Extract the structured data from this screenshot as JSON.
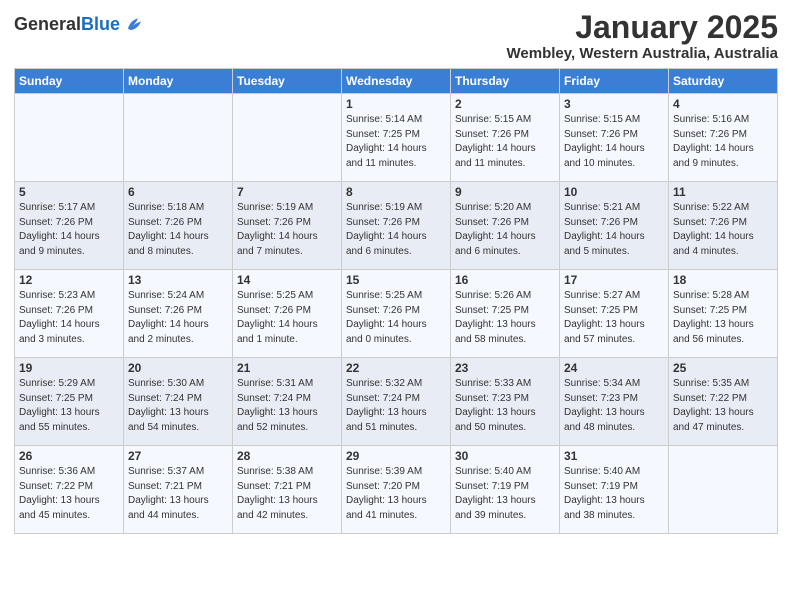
{
  "header": {
    "logo_general": "General",
    "logo_blue": "Blue",
    "month_title": "January 2025",
    "location": "Wembley, Western Australia, Australia"
  },
  "weekdays": [
    "Sunday",
    "Monday",
    "Tuesday",
    "Wednesday",
    "Thursday",
    "Friday",
    "Saturday"
  ],
  "weeks": [
    [
      {
        "day": "",
        "info": ""
      },
      {
        "day": "",
        "info": ""
      },
      {
        "day": "",
        "info": ""
      },
      {
        "day": "1",
        "info": "Sunrise: 5:14 AM\nSunset: 7:25 PM\nDaylight: 14 hours\nand 11 minutes."
      },
      {
        "day": "2",
        "info": "Sunrise: 5:15 AM\nSunset: 7:26 PM\nDaylight: 14 hours\nand 11 minutes."
      },
      {
        "day": "3",
        "info": "Sunrise: 5:15 AM\nSunset: 7:26 PM\nDaylight: 14 hours\nand 10 minutes."
      },
      {
        "day": "4",
        "info": "Sunrise: 5:16 AM\nSunset: 7:26 PM\nDaylight: 14 hours\nand 9 minutes."
      }
    ],
    [
      {
        "day": "5",
        "info": "Sunrise: 5:17 AM\nSunset: 7:26 PM\nDaylight: 14 hours\nand 9 minutes."
      },
      {
        "day": "6",
        "info": "Sunrise: 5:18 AM\nSunset: 7:26 PM\nDaylight: 14 hours\nand 8 minutes."
      },
      {
        "day": "7",
        "info": "Sunrise: 5:19 AM\nSunset: 7:26 PM\nDaylight: 14 hours\nand 7 minutes."
      },
      {
        "day": "8",
        "info": "Sunrise: 5:19 AM\nSunset: 7:26 PM\nDaylight: 14 hours\nand 6 minutes."
      },
      {
        "day": "9",
        "info": "Sunrise: 5:20 AM\nSunset: 7:26 PM\nDaylight: 14 hours\nand 6 minutes."
      },
      {
        "day": "10",
        "info": "Sunrise: 5:21 AM\nSunset: 7:26 PM\nDaylight: 14 hours\nand 5 minutes."
      },
      {
        "day": "11",
        "info": "Sunrise: 5:22 AM\nSunset: 7:26 PM\nDaylight: 14 hours\nand 4 minutes."
      }
    ],
    [
      {
        "day": "12",
        "info": "Sunrise: 5:23 AM\nSunset: 7:26 PM\nDaylight: 14 hours\nand 3 minutes."
      },
      {
        "day": "13",
        "info": "Sunrise: 5:24 AM\nSunset: 7:26 PM\nDaylight: 14 hours\nand 2 minutes."
      },
      {
        "day": "14",
        "info": "Sunrise: 5:25 AM\nSunset: 7:26 PM\nDaylight: 14 hours\nand 1 minute."
      },
      {
        "day": "15",
        "info": "Sunrise: 5:25 AM\nSunset: 7:26 PM\nDaylight: 14 hours\nand 0 minutes."
      },
      {
        "day": "16",
        "info": "Sunrise: 5:26 AM\nSunset: 7:25 PM\nDaylight: 13 hours\nand 58 minutes."
      },
      {
        "day": "17",
        "info": "Sunrise: 5:27 AM\nSunset: 7:25 PM\nDaylight: 13 hours\nand 57 minutes."
      },
      {
        "day": "18",
        "info": "Sunrise: 5:28 AM\nSunset: 7:25 PM\nDaylight: 13 hours\nand 56 minutes."
      }
    ],
    [
      {
        "day": "19",
        "info": "Sunrise: 5:29 AM\nSunset: 7:25 PM\nDaylight: 13 hours\nand 55 minutes."
      },
      {
        "day": "20",
        "info": "Sunrise: 5:30 AM\nSunset: 7:24 PM\nDaylight: 13 hours\nand 54 minutes."
      },
      {
        "day": "21",
        "info": "Sunrise: 5:31 AM\nSunset: 7:24 PM\nDaylight: 13 hours\nand 52 minutes."
      },
      {
        "day": "22",
        "info": "Sunrise: 5:32 AM\nSunset: 7:24 PM\nDaylight: 13 hours\nand 51 minutes."
      },
      {
        "day": "23",
        "info": "Sunrise: 5:33 AM\nSunset: 7:23 PM\nDaylight: 13 hours\nand 50 minutes."
      },
      {
        "day": "24",
        "info": "Sunrise: 5:34 AM\nSunset: 7:23 PM\nDaylight: 13 hours\nand 48 minutes."
      },
      {
        "day": "25",
        "info": "Sunrise: 5:35 AM\nSunset: 7:22 PM\nDaylight: 13 hours\nand 47 minutes."
      }
    ],
    [
      {
        "day": "26",
        "info": "Sunrise: 5:36 AM\nSunset: 7:22 PM\nDaylight: 13 hours\nand 45 minutes."
      },
      {
        "day": "27",
        "info": "Sunrise: 5:37 AM\nSunset: 7:21 PM\nDaylight: 13 hours\nand 44 minutes."
      },
      {
        "day": "28",
        "info": "Sunrise: 5:38 AM\nSunset: 7:21 PM\nDaylight: 13 hours\nand 42 minutes."
      },
      {
        "day": "29",
        "info": "Sunrise: 5:39 AM\nSunset: 7:20 PM\nDaylight: 13 hours\nand 41 minutes."
      },
      {
        "day": "30",
        "info": "Sunrise: 5:40 AM\nSunset: 7:19 PM\nDaylight: 13 hours\nand 39 minutes."
      },
      {
        "day": "31",
        "info": "Sunrise: 5:40 AM\nSunset: 7:19 PM\nDaylight: 13 hours\nand 38 minutes."
      },
      {
        "day": "",
        "info": ""
      }
    ]
  ]
}
